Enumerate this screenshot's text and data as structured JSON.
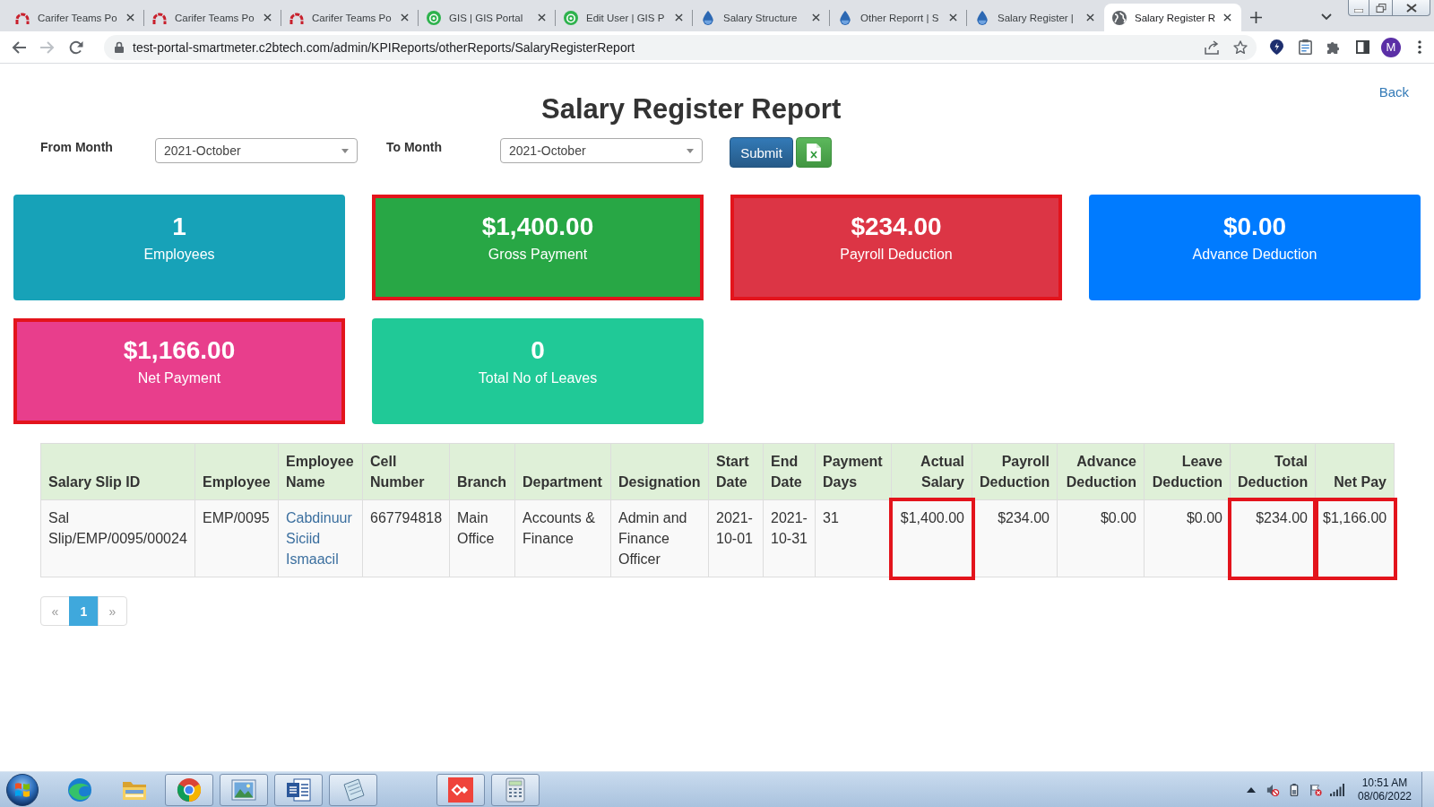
{
  "browser": {
    "tabs": [
      {
        "title": "Carifer Teams Po",
        "kind": "arch",
        "selected": false
      },
      {
        "title": "Carifer Teams Po",
        "kind": "arch",
        "selected": false
      },
      {
        "title": "Carifer Teams Po",
        "kind": "arch",
        "selected": false
      },
      {
        "title": "GIS | GIS Portal",
        "kind": "badge",
        "selected": false
      },
      {
        "title": "Edit User | GIS P",
        "kind": "badge",
        "selected": false
      },
      {
        "title": "Salary Structure",
        "kind": "drop",
        "selected": false
      },
      {
        "title": "Other Reporrt | S",
        "kind": "drop",
        "selected": false
      },
      {
        "title": "Salary Register |",
        "kind": "drop",
        "selected": false
      },
      {
        "title": "Salary Register R",
        "kind": "globe",
        "selected": true
      }
    ],
    "nav_buttons": [
      {
        "kind": "back",
        "disabled": false
      },
      {
        "kind": "forward",
        "disabled": true
      },
      {
        "kind": "reload",
        "disabled": false
      }
    ],
    "address": "test-portal-smartmeter.c2btech.com/admin/KPIReports/otherReports/SalaryRegisterReport",
    "profile_initial": "M"
  },
  "page": {
    "title": "Salary Register Report",
    "back_link": "Back",
    "filters": [
      {
        "label": "From Month",
        "value": "2021-October"
      },
      {
        "label": "To Month",
        "value": "2021-October"
      }
    ],
    "submit_button": "Submit",
    "summary_cards": [
      {
        "value": "1",
        "label": "Employees",
        "color": "#17a2b8",
        "highlighted": false
      },
      {
        "value": "$1,400.00",
        "label": "Gross Payment",
        "color": "#28a745",
        "highlighted": true
      },
      {
        "value": "$234.00",
        "label": "Payroll Deduction",
        "color": "#dc3545",
        "highlighted": true
      },
      {
        "value": "$0.00",
        "label": "Advance Deduction",
        "color": "#007bff",
        "highlighted": false
      },
      {
        "value": "$1,166.00",
        "label": "Net Payment",
        "color": "#e83e8c",
        "highlighted": true
      },
      {
        "value": "0",
        "label": "Total No of Leaves",
        "color": "#20c997",
        "highlighted": false
      }
    ],
    "table": {
      "columns": [
        {
          "label": "Salary Slip ID",
          "kind": "text"
        },
        {
          "label": "Employee",
          "kind": "text"
        },
        {
          "label": "Employee Name",
          "kind": "link"
        },
        {
          "label": "Cell Number",
          "kind": "text"
        },
        {
          "label": "Branch",
          "kind": "text"
        },
        {
          "label": "Department",
          "kind": "text"
        },
        {
          "label": "Designation",
          "kind": "text"
        },
        {
          "label": "Start Date",
          "kind": "text"
        },
        {
          "label": "End Date",
          "kind": "text"
        },
        {
          "label": "Payment Days",
          "kind": "text"
        },
        {
          "label": "Actual Salary",
          "kind": "amount"
        },
        {
          "label": "Payroll Deduction",
          "kind": "amount"
        },
        {
          "label": "Advance Deduction",
          "kind": "amount"
        },
        {
          "label": "Leave Deduction",
          "kind": "amount"
        },
        {
          "label": "Total Deduction",
          "kind": "amount"
        },
        {
          "label": "Net Pay",
          "kind": "amount"
        }
      ],
      "rows": [
        {
          "cells": [
            {
              "text": "Sal Slip/EMP/0095/00024",
              "highlighted": false
            },
            {
              "text": "EMP/0095",
              "highlighted": false
            },
            {
              "text": "Cabdinuur Siciid Ismaacil",
              "highlighted": false
            },
            {
              "text": "667794818",
              "highlighted": false
            },
            {
              "text": "Main Office",
              "highlighted": false
            },
            {
              "text": "Accounts & Finance",
              "highlighted": false
            },
            {
              "text": "Admin and Finance Officer",
              "highlighted": false
            },
            {
              "text": "2021-10-01",
              "highlighted": false
            },
            {
              "text": "2021-10-31",
              "highlighted": false
            },
            {
              "text": "31",
              "highlighted": false
            },
            {
              "text": "$1,400.00",
              "highlighted": true
            },
            {
              "text": "$234.00",
              "highlighted": false
            },
            {
              "text": "$0.00",
              "highlighted": false
            },
            {
              "text": "$0.00",
              "highlighted": false
            },
            {
              "text": "$234.00",
              "highlighted": true
            },
            {
              "text": "$1,166.00",
              "highlighted": true
            }
          ]
        }
      ]
    },
    "pagination": [
      {
        "label": "«",
        "selected": false,
        "disabled": true
      },
      {
        "label": "1",
        "selected": true,
        "disabled": false
      },
      {
        "label": "»",
        "selected": false,
        "disabled": true
      }
    ]
  },
  "taskbar": {
    "apps": [
      {
        "kind": "edge",
        "running": false
      },
      {
        "kind": "folder",
        "running": false
      },
      {
        "kind": "chrome",
        "running": true
      },
      {
        "kind": "photo",
        "running": true
      },
      {
        "kind": "word",
        "running": true
      },
      {
        "kind": "notepad",
        "running": true
      },
      {
        "kind": "remote",
        "running": true
      },
      {
        "kind": "calculator",
        "running": true
      }
    ],
    "clock": {
      "time": "10:51 AM",
      "date": "08/06/2022"
    }
  }
}
